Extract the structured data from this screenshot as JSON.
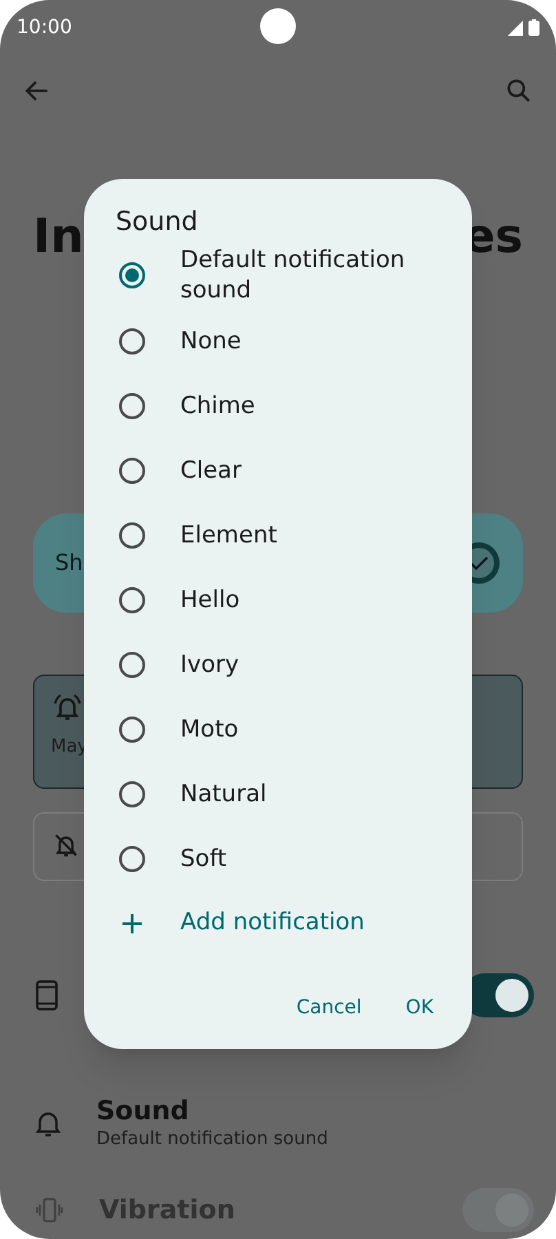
{
  "status_bar": {
    "time": "10:00"
  },
  "background": {
    "title_fragments": [
      "In",
      "es"
    ],
    "highlight_card": {
      "text": "Sh",
      "checked": true
    },
    "mode_cards": [
      {
        "text": "May",
        "selected": true
      },
      {
        "selected": false
      }
    ],
    "display_toggle": {
      "on": true
    },
    "sound_row": {
      "title": "Sound",
      "subtitle": "Default notification sound"
    },
    "vibration_row": {
      "title": "Vibration",
      "on": true,
      "disabled": true
    }
  },
  "dialog": {
    "title": "Sound",
    "options": [
      {
        "label": "Default notification sound",
        "selected": true
      },
      {
        "label": "None",
        "selected": false
      },
      {
        "label": "Chime",
        "selected": false
      },
      {
        "label": "Clear",
        "selected": false
      },
      {
        "label": "Element",
        "selected": false
      },
      {
        "label": "Hello",
        "selected": false
      },
      {
        "label": "Ivory",
        "selected": false
      },
      {
        "label": "Moto",
        "selected": false
      },
      {
        "label": "Natural",
        "selected": false
      },
      {
        "label": "Soft",
        "selected": false
      }
    ],
    "add_button": "Add notification",
    "buttons": [
      "Cancel",
      "OK"
    ]
  }
}
